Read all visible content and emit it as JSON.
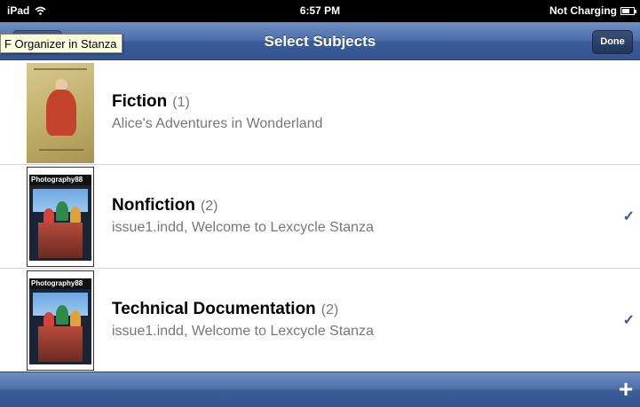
{
  "status_bar": {
    "device": "iPad",
    "time": "6:57 PM",
    "charging": "Not Charging"
  },
  "nav": {
    "title": "Select Subjects",
    "done_label": "Done",
    "tooltip": "F Organizer in Stanza"
  },
  "rows": [
    {
      "title": "Fiction",
      "count": "(1)",
      "subtitle": "Alice's Adventures in Wonderland",
      "checked": false
    },
    {
      "title": "Nonfiction",
      "count": "(2)",
      "subtitle": "issue1.indd, Welcome to Lexcycle Stanza",
      "checked": true,
      "cover_label": "Photography88"
    },
    {
      "title": "Technical Documentation",
      "count": "(2)",
      "subtitle": "issue1.indd, Welcome to Lexcycle Stanza",
      "checked": true,
      "cover_label": "Photography88"
    }
  ],
  "check_mark": "✓",
  "toolbar": {
    "add_symbol": "+"
  },
  "colors": {
    "nav_blue": "#4b6da8",
    "check_blue": "#3b5998",
    "subtitle_gray": "#777777"
  }
}
